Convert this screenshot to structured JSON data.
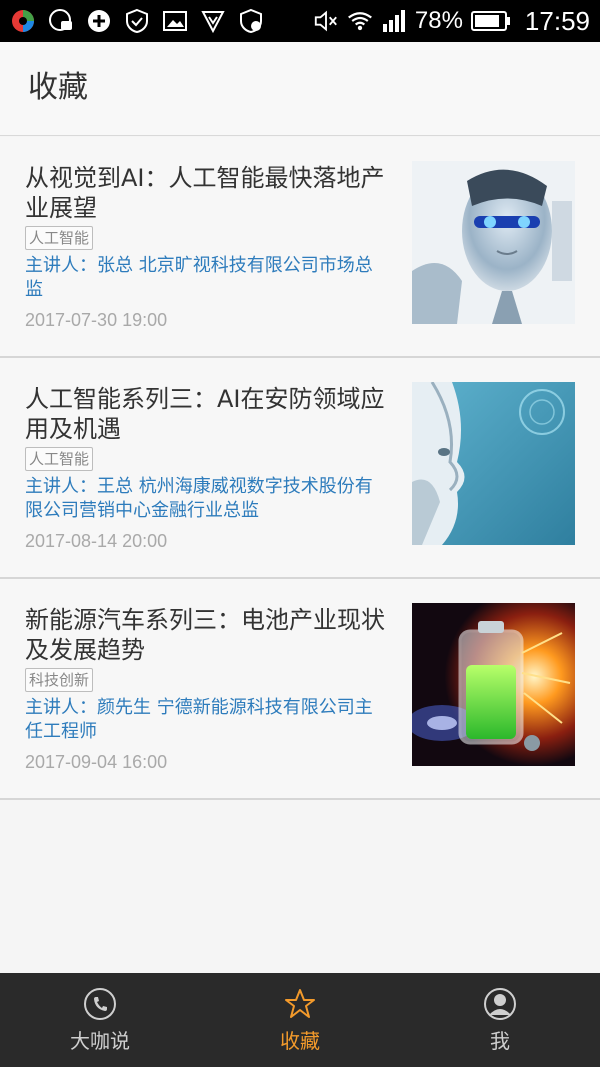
{
  "status_bar": {
    "battery_percent": "78%",
    "time": "17:59",
    "left_icons": [
      "app-icon",
      "cache-icon",
      "add-icon",
      "shield-icon",
      "image-icon",
      "vpn-icon",
      "security-icon"
    ],
    "right_icons": [
      "mute-icon",
      "wifi-icon",
      "signal-icon",
      "battery-icon"
    ]
  },
  "header": {
    "title": "收藏"
  },
  "list": {
    "items": [
      {
        "title": "从视觉到AI：人工智能最快落地产业展望",
        "tag": "人工智能",
        "speaker": "主讲人：张总 北京旷视科技有限公司市场总监",
        "date": "2017-07-30 19:00",
        "image": "ai-robot-face"
      },
      {
        "title": "人工智能系列三：AI在安防领域应用及机遇",
        "tag": "人工智能",
        "speaker": "主讲人：王总 杭州海康威视数字技术股份有限公司营销中心金融行业总监",
        "date": "2017-08-14 20:00",
        "image": "ai-robot-profile"
      },
      {
        "title": "新能源汽车系列三：电池产业现状及发展趋势",
        "tag": "科技创新",
        "speaker": "主讲人：颜先生 宁德新能源科技有限公司主任工程师",
        "date": "2017-09-04 16:00",
        "image": "glowing-battery"
      }
    ]
  },
  "bottom_nav": {
    "items": [
      {
        "label": "大咖说",
        "icon": "phone-chat-icon",
        "active": false
      },
      {
        "label": "收藏",
        "icon": "star-icon",
        "active": true
      },
      {
        "label": "我",
        "icon": "person-icon",
        "active": false
      }
    ]
  },
  "colors": {
    "accent": "#f39a2b",
    "link": "#2e7cbc",
    "nav_bg": "#2a2a2a"
  }
}
